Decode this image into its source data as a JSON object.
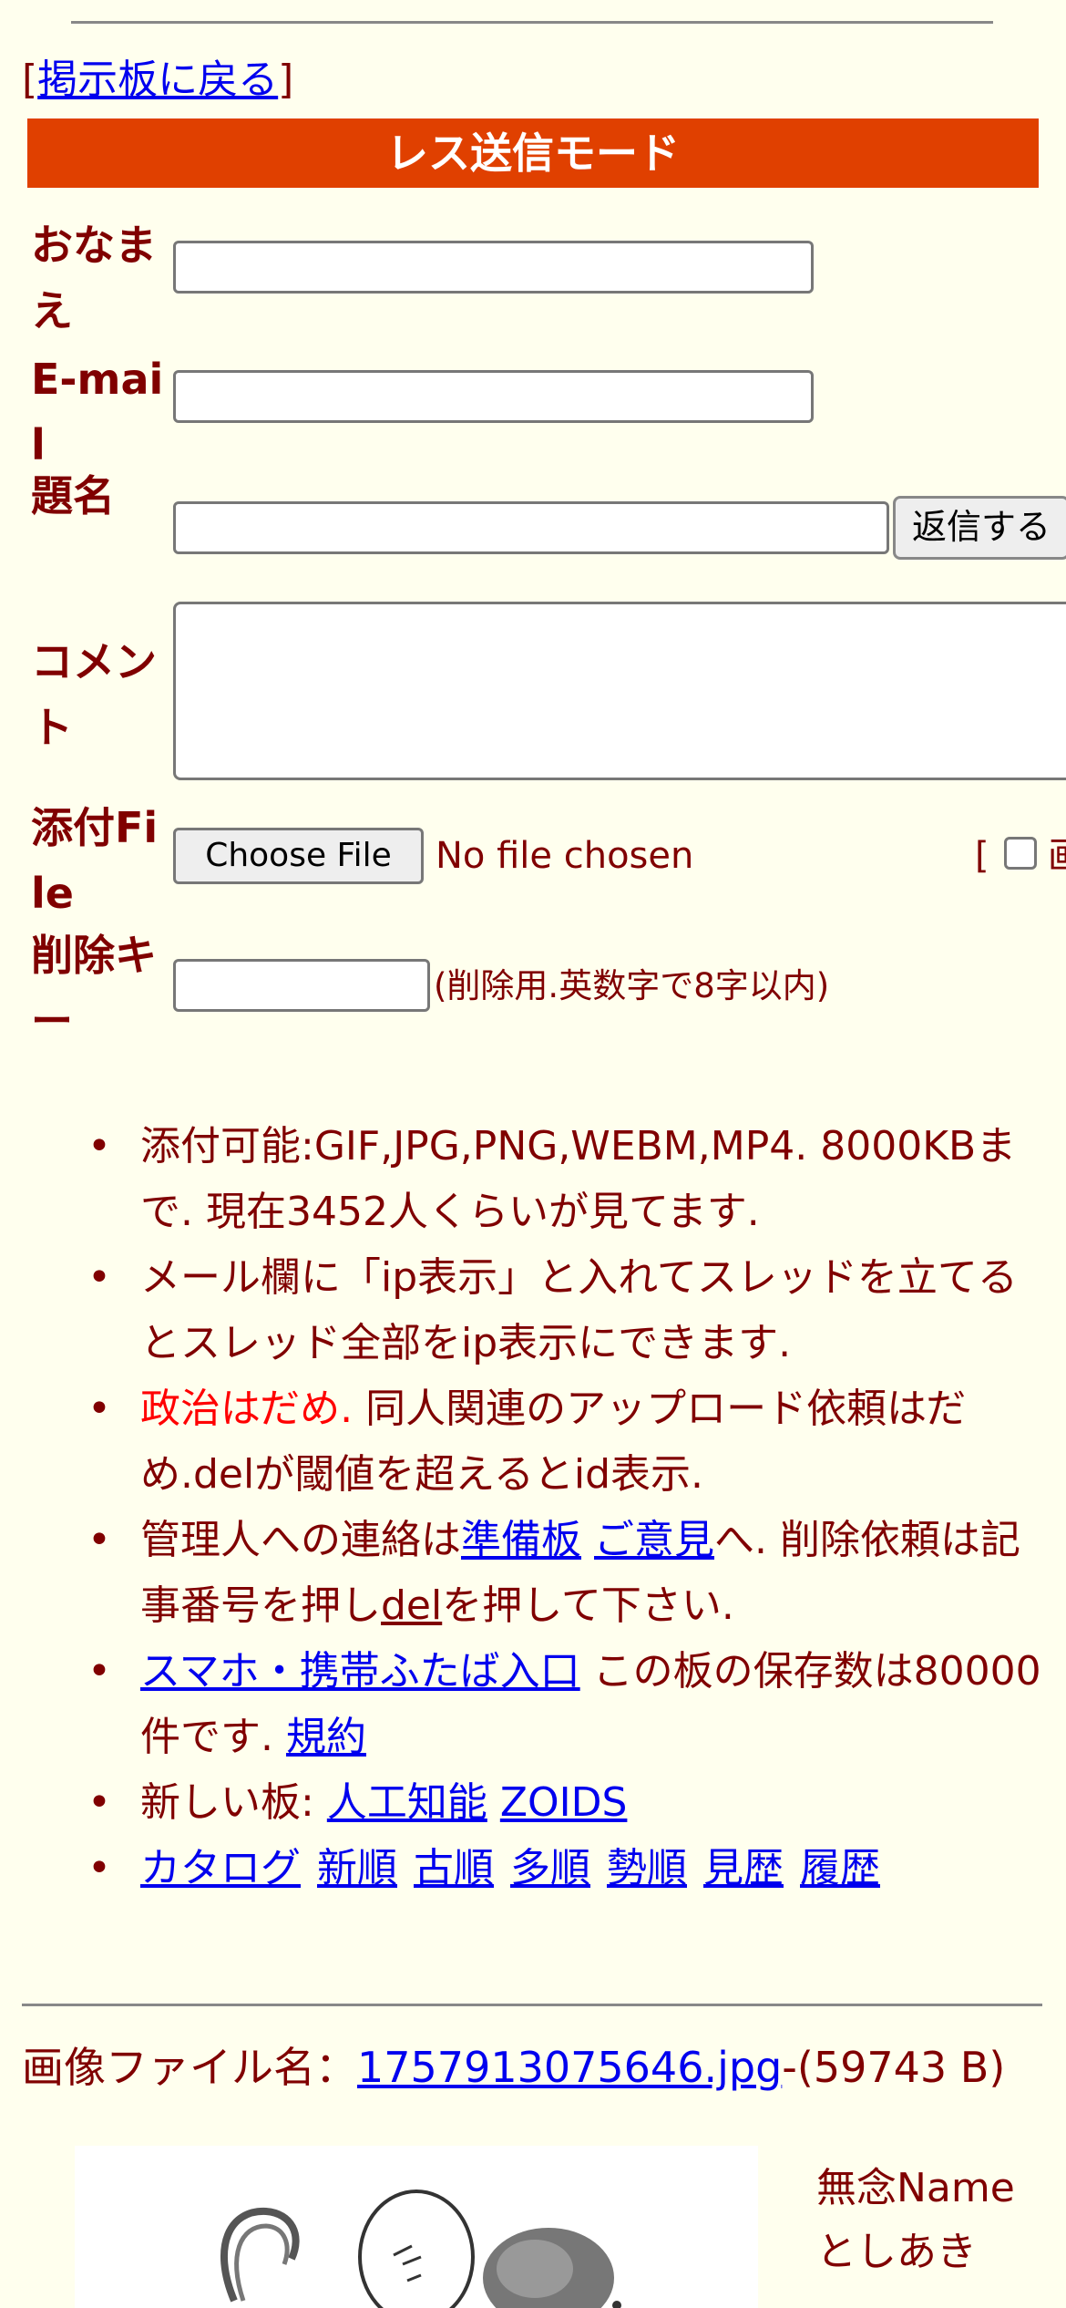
{
  "nav": {
    "back_link": "掲示板に戻る"
  },
  "header": {
    "mode_title": "レス送信モード"
  },
  "form": {
    "name_label": "おなまえ",
    "email_label": "E-mail",
    "subject_label": "題名",
    "comment_label": "コメント",
    "file_label": "添付File",
    "delete_key_label": "削除キー",
    "reply_button": "返信する",
    "choose_file": "Choose File",
    "no_file": "No file chosen",
    "clipped_check_label": "画",
    "delete_key_note": "(削除用.英数字で8字以内)"
  },
  "info": {
    "line1": "添付可能:GIF,JPG,PNG,WEBM,MP4. 8000KBまで. 現在3452人くらいが見てます.",
    "line2": "メール欄に「ip表示」と入れてスレッドを立てるとスレッド全部をip表示にできます.",
    "politics": "政治はだめ.",
    "line3_rest": "同人関連のアップロード依頼はだめ.delが閾値を超えるとid表示.",
    "contact_prefix": "管理人への連絡は",
    "contact_link1": "準備板",
    "contact_link2": "ご意見",
    "contact_mid": "へ. 削除依頼は記事番号を押し",
    "del_link": "del",
    "contact_suffix": "を押して下さい.",
    "mobile_link": "スマホ・携帯ふたば入口",
    "storage_text": "この板の保存数は80000件です.",
    "terms_link": "規約",
    "new_boards_label": "新しい板:",
    "new_board1": "人工知能",
    "new_board2": "ZOIDS",
    "links": [
      "カタログ",
      "新順",
      "古順",
      "多順",
      "勢順",
      "見歴",
      "履歴"
    ]
  },
  "post": {
    "filename_label": "画像ファイル名：",
    "filename_link": "1757913075646.jpg",
    "filesize": "-(59743 B)",
    "name": "無念Name",
    "poster": "としあき"
  },
  "colors": {
    "background": "#ffffee",
    "text": "#800000",
    "header_bar": "#e04000",
    "link": "#0000ee",
    "politics": "#ff0000"
  }
}
